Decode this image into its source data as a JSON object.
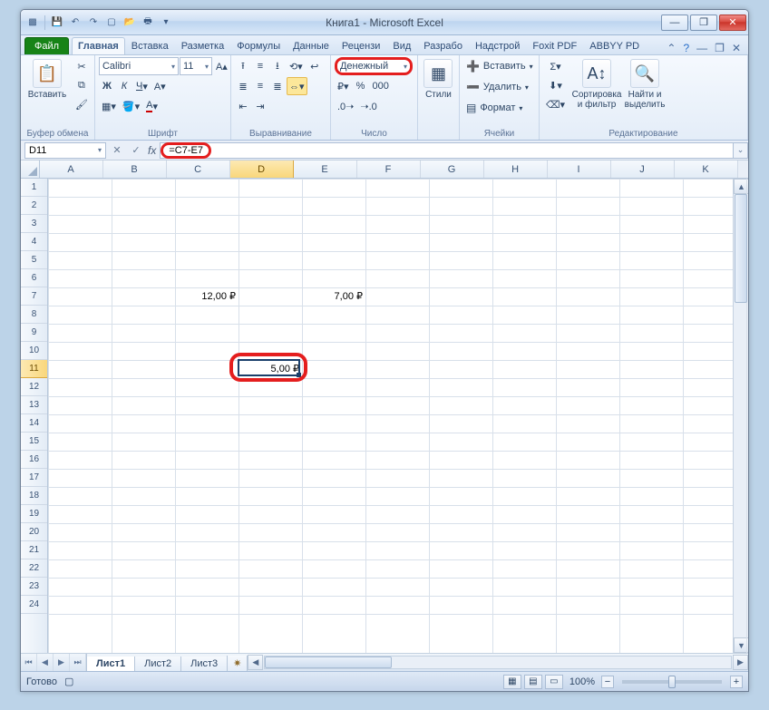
{
  "title": "Книга1  -  Microsoft Excel",
  "qat_icons": [
    "excel-icon",
    "save-icon",
    "undo-icon",
    "redo-icon",
    "new-icon",
    "open-icon",
    "print-preview-icon",
    "qat-more-icon"
  ],
  "win": {
    "min": "—",
    "max": "❐",
    "close": "✕"
  },
  "tabs": {
    "file": "Файл",
    "items": [
      "Главная",
      "Вставка",
      "Разметка",
      "Формулы",
      "Данные",
      "Рецензи",
      "Вид",
      "Разрабо",
      "Надстрой",
      "Foxit PDF",
      "ABBYY PD"
    ],
    "active": 0,
    "help": "?"
  },
  "ribbon": {
    "clipboard": {
      "label": "Буфер обмена",
      "paste": "Вставить"
    },
    "font": {
      "label": "Шрифт",
      "name": "Calibri",
      "size": "11"
    },
    "align": {
      "label": "Выравнивание"
    },
    "number": {
      "label": "Число",
      "format": "Денежный"
    },
    "styles": {
      "label": "Стили"
    },
    "cells": {
      "label": "Ячейки",
      "insert": "Вставить",
      "delete": "Удалить",
      "format": "Формат"
    },
    "editing": {
      "label": "Редактирование",
      "sort": "Сортировка и фильтр",
      "find": "Найти и выделить"
    }
  },
  "namebox": "D11",
  "formula": "=C7-E7",
  "columns": [
    "A",
    "B",
    "C",
    "D",
    "E",
    "F",
    "G",
    "H",
    "I",
    "J",
    "K"
  ],
  "rows": 24,
  "active_cell": {
    "col": 3,
    "row": 11
  },
  "cell_data": {
    "C7": "12,00 ₽",
    "E7": "7,00 ₽",
    "D11": "5,00 ₽"
  },
  "sheets": {
    "items": [
      "Лист1",
      "Лист2",
      "Лист3"
    ],
    "active": 0
  },
  "status": {
    "ready": "Готово",
    "zoom": "100%"
  }
}
